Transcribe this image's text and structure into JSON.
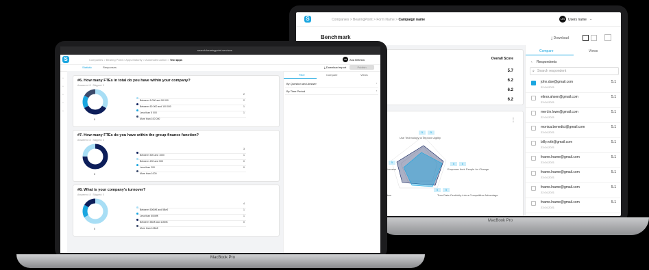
{
  "back": {
    "breadcrumb": [
      "Companies",
      "BearingPoint",
      "Form Name"
    ],
    "campaign": "Campaign name",
    "user_initials": "UN",
    "user_name": "Users name",
    "page_title": "Benchmark",
    "download": "Download",
    "tabs": [
      "Compare",
      "Views"
    ],
    "respondents_label": "Respondents",
    "search_placeholder": "Search respondent",
    "overall_score_label": "Overall Score",
    "scores": [
      "5.7",
      "6.2",
      "6.2",
      "6.2"
    ],
    "respondents": [
      {
        "email": "john.doe@gmail.com",
        "date": "22.04.2021",
        "score": "5.1",
        "checked": true
      },
      {
        "email": "elinor.ahsen@gmail.com",
        "date": "23.04.2021",
        "score": "5.1",
        "checked": false
      },
      {
        "email": "mert.in.lowe@gmail.com",
        "date": "22.04.2021",
        "score": "5.1",
        "checked": false
      },
      {
        "email": "monica.benedict@gmail.com",
        "date": "23.04.2021",
        "score": "5.1",
        "checked": false
      },
      {
        "email": "billy.roth@gmail.com",
        "date": "23.04.2021",
        "score": "5.1",
        "checked": false
      },
      {
        "email": "fname.lname@gmail.com",
        "date": "23.04.2021",
        "score": "5.1",
        "checked": false
      },
      {
        "email": "fname.lname@gmail.com",
        "date": "23.04.2021",
        "score": "5.1",
        "checked": false
      },
      {
        "email": "fname.lname@gmail.com",
        "date": "22.04.2021",
        "score": "5.1",
        "checked": false
      },
      {
        "email": "fname.lname@gmail.com",
        "date": "23.04.2021",
        "score": "5.1",
        "checked": false
      }
    ],
    "radar_labels": [
      "Use Technology to Improve Agility",
      "Empower their People for Change",
      "Turn Data Centricity into a Competitive Advantage",
      "Economic Ecosystem",
      "Success"
    ],
    "radar_pill_value": "5",
    "base_label": "MacBook Pro"
  },
  "front": {
    "url": "search.bearingpoint.services",
    "breadcrumb": [
      "Companies",
      "Bearing Point",
      "Apps Maturity",
      "Automated Action"
    ],
    "current": "Test apps",
    "user_initials": "AB",
    "user_name": "Ana Britesta",
    "left_tabs": [
      "Statistic",
      "Responses"
    ],
    "download_report": "Download report",
    "publish": "Publish",
    "right_tabs": [
      "Filter",
      "Compare",
      "Views"
    ],
    "filters": [
      "By Question and Answer",
      "By Time Period"
    ],
    "answered_label": "Answered: 8",
    "skipped_label": "Skipped: 0",
    "questions": [
      {
        "title": "#6. How many FTEs in total do you have within your company?",
        "legend": [
          {
            "label": "Between 5 000 and 50 000",
            "value": "2",
            "color": "#a8def5"
          },
          {
            "label": "Between 50 000 and 100 000",
            "value": "2",
            "color": "#0d1e5a"
          },
          {
            "label": "Less than 5 000",
            "value": "1",
            "color": "#1aa6e0"
          },
          {
            "label": "More than 100 000",
            "value": "1",
            "color": "#3b4a6b"
          }
        ]
      },
      {
        "title": "#7. How many FTEs do you have within the group finance function?",
        "legend": [
          {
            "label": "Between 500 and 1000",
            "value": "3",
            "color": "#0d1e5a"
          },
          {
            "label": "Between 200 and 500",
            "value": "1",
            "color": "#a8def5"
          },
          {
            "label": "Less than 200",
            "value": "0",
            "color": "#1aa6e0"
          },
          {
            "label": "More than 1000",
            "value": "0",
            "color": "#3b4a6b"
          }
        ]
      },
      {
        "title": "#8. What is your company's turnover?",
        "legend": [
          {
            "label": "Between 500M€ and 5Bn€",
            "value": "4",
            "color": "#a8def5"
          },
          {
            "label": "Less than 500M€",
            "value": "1",
            "color": "#1aa6e0"
          },
          {
            "label": "Between 5Bn€ and 10Bn€",
            "value": "1",
            "color": "#0d1e5a"
          },
          {
            "label": "More than 10Bn€",
            "value": "0",
            "color": "#3b4a6b"
          }
        ]
      }
    ],
    "donut_center_value": "8",
    "base_label": "MacBook Pro"
  },
  "colors": {
    "accent": "#1aa6e0",
    "navy": "#0d1e5a"
  }
}
